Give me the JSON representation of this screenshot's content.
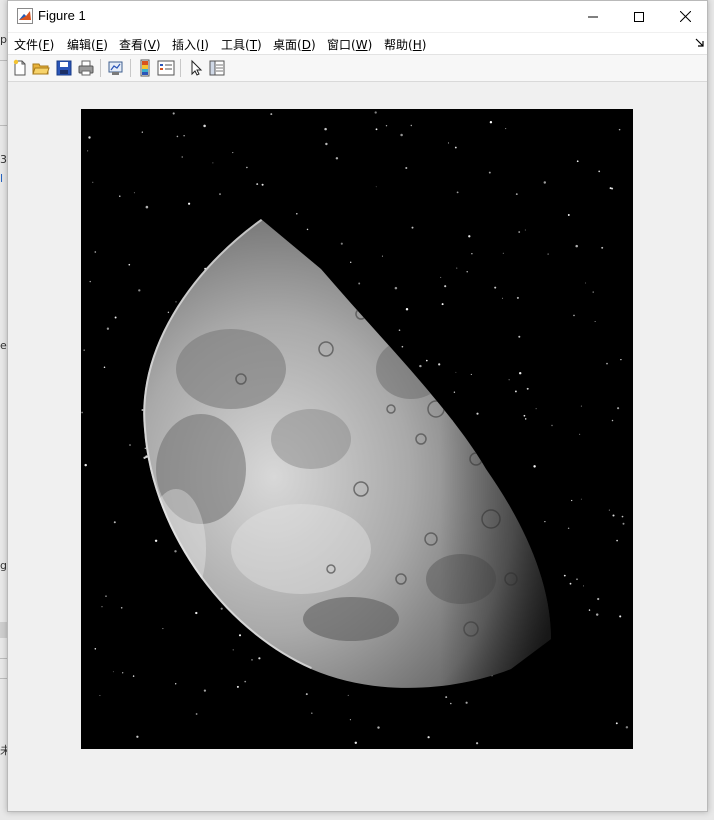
{
  "window": {
    "title": "Figure 1"
  },
  "menu": {
    "items": [
      {
        "text": "文件(",
        "key": "F",
        "end": ")"
      },
      {
        "text": "编辑(",
        "key": "E",
        "end": ")"
      },
      {
        "text": "查看(",
        "key": "V",
        "end": ")"
      },
      {
        "text": "插入(",
        "key": "I",
        "end": ")"
      },
      {
        "text": "工具(",
        "key": "T",
        "end": ")"
      },
      {
        "text": "桌面(",
        "key": "D",
        "end": ")"
      },
      {
        "text": "窗口(",
        "key": "W",
        "end": ")"
      },
      {
        "text": "帮助(",
        "key": "H",
        "end": ")"
      }
    ]
  },
  "toolbar": {
    "buttons": [
      "new-figure-icon",
      "open-file-icon",
      "save-icon",
      "print-icon",
      "link-plot-icon",
      "colorbar-icon",
      "legend-icon",
      "edit-plot-icon",
      "property-inspector-icon"
    ]
  },
  "background_window": {
    "fragments": [
      "p",
      "3",
      "l",
      "er",
      "g",
      "未"
    ]
  },
  "colors": {
    "window_bg": "#f0f0f0",
    "title_bar": "#ffffff",
    "image_bg": "#000000",
    "matlab_icon_orange": "#d9531e",
    "matlab_icon_blue": "#1f5fbf"
  }
}
